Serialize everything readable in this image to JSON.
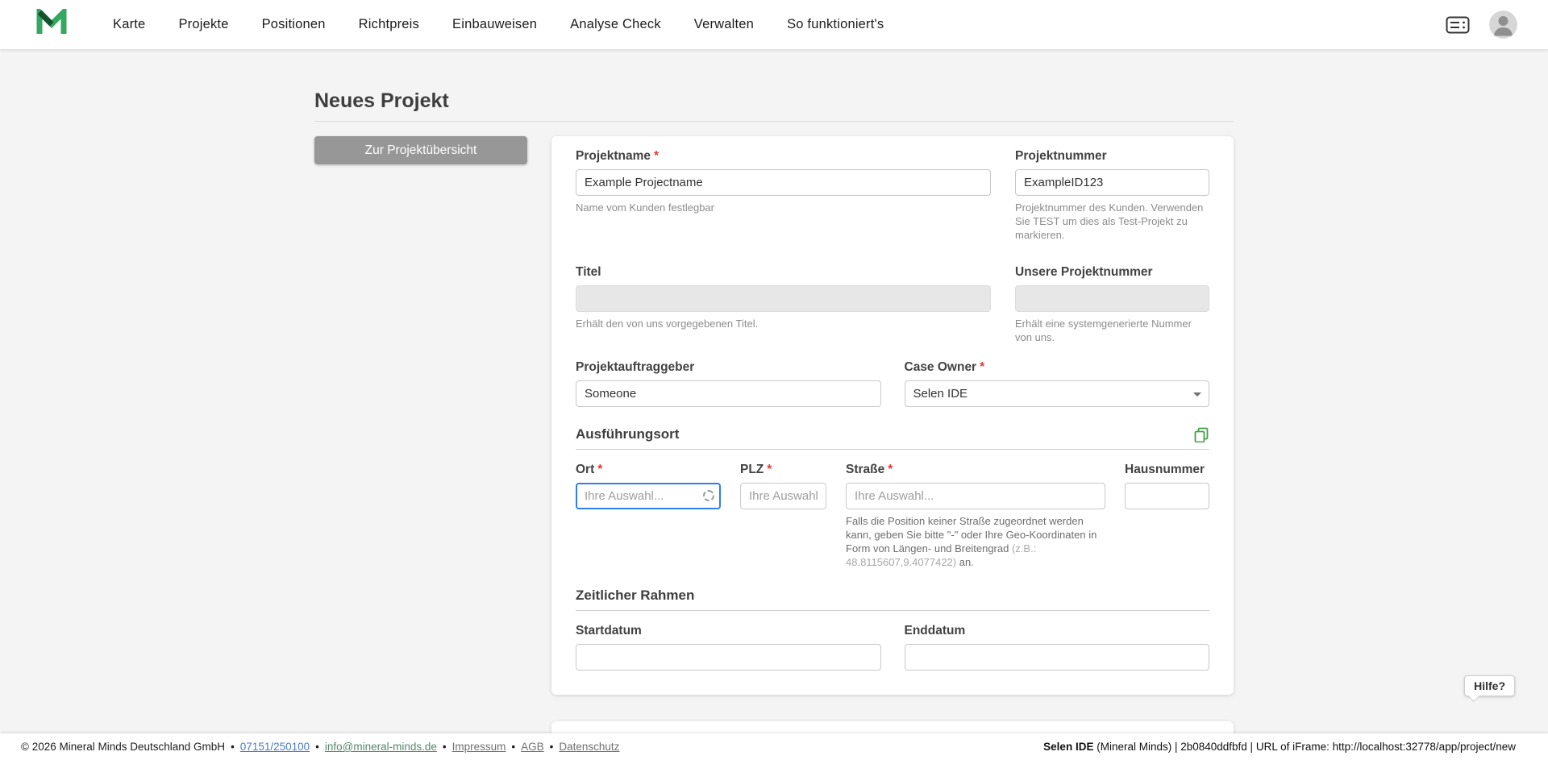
{
  "navbar": {
    "items": [
      {
        "label": "Karte"
      },
      {
        "label": "Projekte"
      },
      {
        "label": "Positionen"
      },
      {
        "label": "Richtpreis"
      },
      {
        "label": "Einbauweisen"
      },
      {
        "label": "Analyse Check"
      },
      {
        "label": "Verwalten"
      },
      {
        "label": "So funktioniert's"
      }
    ]
  },
  "page": {
    "title": "Neues Projekt",
    "back_button": "Zur Projektübersicht"
  },
  "form": {
    "projektname": {
      "label": "Projektname",
      "required": "*",
      "value": "Example Projectname",
      "helper": "Name vom Kunden festlegbar"
    },
    "projektnummer": {
      "label": "Projektnummer",
      "value": "ExampleID123",
      "helper": "Projektnummer des Kunden. Verwenden Sie TEST um dies als Test-Projekt zu markieren."
    },
    "titel": {
      "label": "Titel",
      "value": "",
      "helper": "Erhält den von uns vorgegebenen Titel."
    },
    "unsere_projektnummer": {
      "label": "Unsere Projektnummer",
      "value": "",
      "helper": "Erhält eine systemgenerierte Nummer von uns."
    },
    "projektauftraggeber": {
      "label": "Projektauftraggeber",
      "value": "Someone"
    },
    "case_owner": {
      "label": "Case Owner",
      "required": "*",
      "value": "Selen IDE"
    },
    "ausfuehrungsort": {
      "heading": "Ausführungsort",
      "ort": {
        "label": "Ort",
        "required": "*",
        "placeholder": "Ihre Auswahl..."
      },
      "plz": {
        "label": "PLZ",
        "required": "*",
        "placeholder": "Ihre Auswahl."
      },
      "strasse": {
        "label": "Straße",
        "required": "*",
        "placeholder": "Ihre Auswahl...",
        "helper_1": "Falls die Position keiner Straße zugeordnet werden kann, geben Sie bitte \"-\" oder Ihre Geo-Koordinaten in Form von Längen- und Breitengrad ",
        "helper_2": "(z.B.: 48.8115607,9.4077422)",
        "helper_3": " an."
      },
      "hausnummer": {
        "label": "Hausnummer"
      }
    },
    "zeitlicher_rahmen": {
      "heading": "Zeitlicher Rahmen",
      "startdatum": {
        "label": "Startdatum"
      },
      "enddatum": {
        "label": "Enddatum"
      }
    }
  },
  "help": {
    "label": "Hilfe?"
  },
  "footer": {
    "separator": "•",
    "copyright": "© 2026 Mineral Minds Deutschland GmbH",
    "phone": "07151/250100",
    "email": "info@mineral-minds.de",
    "impressum": "Impressum",
    "agb": "AGB",
    "datenschutz": "Datenschutz",
    "right_user": "Selen IDE",
    "right_rest": " (Mineral Minds) | 2b0840ddfbfd | URL of iFrame: http://localhost:32778/app/project/new"
  },
  "icons": {
    "logo": "mineral-minds-logo",
    "top_right_1": "server-icon",
    "top_right_2": "user-avatar-icon",
    "section": "copy-icon",
    "select": "chevron-down-icon",
    "ort_loading": "spinner-icon"
  },
  "colors": {
    "accent_green": "#35a860",
    "focus_blue": "#2f80ed",
    "required_red": "#e53935",
    "button_gray": "#979797",
    "background": "#f4f4f4"
  }
}
